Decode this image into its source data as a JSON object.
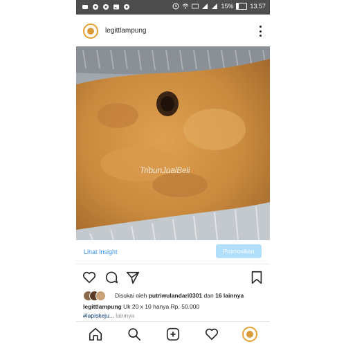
{
  "status_bar": {
    "battery": "15%",
    "time": "13.57",
    "icons": [
      "chat-icon",
      "settings-icon",
      "image-icon",
      "clock-icon",
      "wifi-icon",
      "volte-icon",
      "signal-icon",
      "battery-icon"
    ]
  },
  "post": {
    "username": "legittlampung",
    "watermark": "TribunJualBeli",
    "insight_link": "Lihat Insight",
    "promote_button": "Promosikan",
    "likes_prefix": "Disukai oleh",
    "likes_user": "putriwulandari0301",
    "likes_and": "dan",
    "likes_others": "16 lainnya",
    "caption_user": "legittlampung",
    "caption_text": "Uk 20 x 10 hanya Rp. 50.000",
    "hashtag": "#lapiskeju...",
    "more": "lainnya"
  },
  "colors": {
    "link_blue": "#3897f0",
    "promote_bg": "#b2dffc",
    "status_bar": "#4d4d4d",
    "avatar_ring": "#e8a030"
  },
  "icons": {
    "actions": [
      "heart-icon",
      "comment-icon",
      "share-icon",
      "bookmark-icon"
    ],
    "nav": [
      "home-icon",
      "search-icon",
      "add-post-icon",
      "activity-heart-icon",
      "profile-avatar"
    ]
  }
}
